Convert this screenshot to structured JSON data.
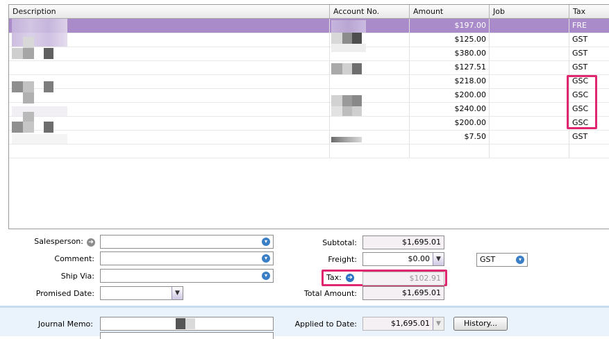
{
  "grid": {
    "columns": [
      "Description",
      "Account No.",
      "Amount",
      "Job",
      "Tax"
    ],
    "rows": [
      {
        "amount": "$197.00",
        "job": "",
        "tax": "FRE",
        "selected": true
      },
      {
        "amount": "$125.00",
        "job": "",
        "tax": "GST"
      },
      {
        "amount": "$380.00",
        "job": "",
        "tax": "GST"
      },
      {
        "amount": "$127.51",
        "job": "",
        "tax": "GST"
      },
      {
        "amount": "$218.00",
        "job": "",
        "tax": "GSC"
      },
      {
        "amount": "$200.00",
        "job": "",
        "tax": "GSC"
      },
      {
        "amount": "$240.00",
        "job": "",
        "tax": "GSC"
      },
      {
        "amount": "$200.00",
        "job": "",
        "tax": "GSC"
      },
      {
        "amount": "$7.50",
        "job": "",
        "tax": "GST"
      }
    ]
  },
  "form": {
    "salesperson_label": "Salesperson:",
    "salesperson_value": "",
    "comment_label": "Comment:",
    "comment_value": "",
    "ship_via_label": "Ship Via:",
    "ship_via_value": "",
    "promised_date_label": "Promised Date:",
    "promised_date_value": "",
    "journal_memo_label": "Journal Memo:"
  },
  "totals": {
    "subtotal_label": "Subtotal:",
    "subtotal_value": "$1,695.01",
    "freight_label": "Freight:",
    "freight_value": "$0.00",
    "freight_tax_code": "GST",
    "tax_label": "Tax:",
    "tax_value": "$102.91",
    "total_label": "Total Amount:",
    "total_value": "$1,695.01",
    "applied_label": "Applied to Date:",
    "applied_value": "$1,695.01",
    "history_button": "History..."
  },
  "colors": {
    "selected_row": "#a88bc8",
    "highlight": "#e0266f",
    "combo_icon": "#3a7fc6"
  },
  "icons": {
    "salesperson": "arrow-right-icon",
    "tax": "arrow-right-icon",
    "combo": "chevron-down-icon"
  }
}
